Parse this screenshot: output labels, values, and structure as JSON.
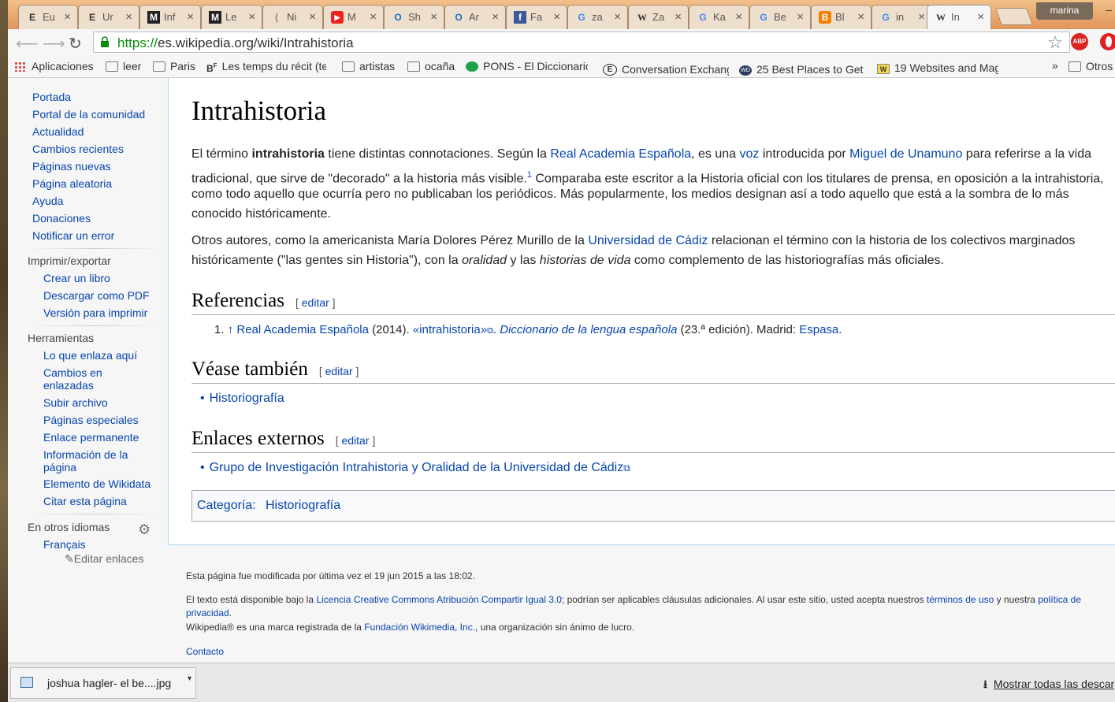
{
  "browser": {
    "tabs": [
      {
        "favicon": "E",
        "title": "Eu"
      },
      {
        "favicon": "E",
        "title": "Ur"
      },
      {
        "favicon": "M",
        "title": "Inf"
      },
      {
        "favicon": "M",
        "title": "Le"
      },
      {
        "favicon": "(",
        "title": "Ni"
      },
      {
        "favicon": "▶",
        "title": "M"
      },
      {
        "favicon": "O",
        "title": "Sh"
      },
      {
        "favicon": "O",
        "title": "Ar"
      },
      {
        "favicon": "f",
        "title": "Fa"
      },
      {
        "favicon": "G",
        "title": "za"
      },
      {
        "favicon": "W",
        "title": "Za"
      },
      {
        "favicon": "G",
        "title": "Ka"
      },
      {
        "favicon": "G",
        "title": "Be"
      },
      {
        "favicon": "B",
        "title": "Bl"
      },
      {
        "favicon": "G",
        "title": "in"
      },
      {
        "favicon": "W",
        "title": "In"
      }
    ],
    "profile": "marina",
    "url_scheme": "https://",
    "url_rest": "es.wikipedia.org/wiki/Intrahistoria",
    "abp_label": "ABP",
    "bookmarks": [
      {
        "icon": "apps-grid-icon",
        "label": "Aplicaciones"
      },
      {
        "icon": "folder-icon",
        "label": "leer"
      },
      {
        "icon": "folder-icon",
        "label": "Paris"
      },
      {
        "icon": "bf-icon",
        "label": "Les temps du récit (te"
      },
      {
        "icon": "folder-icon",
        "label": "artistas"
      },
      {
        "icon": "folder-icon",
        "label": "ocaña"
      },
      {
        "icon": "pons-icon",
        "label": "PONS - El Diccionario"
      },
      {
        "icon": "e-icon",
        "label": "Conversation Exchang"
      },
      {
        "icon": "wd-icon",
        "label": "25 Best Places to Get"
      },
      {
        "icon": "w-icon",
        "label": "19 Websites and Mag"
      }
    ],
    "bookmarks_overflow": "»",
    "other_bookmarks": "Otros"
  },
  "sidebar": {
    "nav": [
      "Portada",
      "Portal de la comunidad",
      "Actualidad",
      "Cambios recientes",
      "Páginas nuevas",
      "Página aleatoria",
      "Ayuda",
      "Donaciones",
      "Notificar un error"
    ],
    "print_heading": "Imprimir/exportar",
    "print": [
      "Crear un libro",
      "Descargar como PDF",
      "Versión para imprimir"
    ],
    "tools_heading": "Herramientas",
    "tools": [
      "Lo que enlaza aquí",
      "Cambios en",
      "enlazadas",
      "Subir archivo",
      "Páginas especiales",
      "Enlace permanente",
      "Información de la",
      "página",
      "Elemento de Wikidata",
      "Citar esta página"
    ],
    "lang_heading": "En otros idiomas",
    "langs": [
      "Français"
    ],
    "edit_links": "Editar enlaces"
  },
  "article": {
    "title": "Intrahistoria",
    "p1": {
      "a": "El término ",
      "b": "intrahistoria",
      "c": " tiene distintas connotaciones. Según la ",
      "d": "Real Academia Española",
      "e": ", es una ",
      "f": "voz",
      "g": " introducida por ",
      "h": "Miguel de Unamuno",
      "i": " para referirse a la vida",
      "l2a": "tradicional, que sirve de \"decorado\" a la historia más visible.",
      "sup": "1",
      "l2b": " Comparaba este escritor a la Historia oficial con los titulares de prensa, en oposición a la intrahistoria,",
      "l3": "como todo aquello que ocurría pero no publicaban los periódicos. Más popularmente, los medios designan así a todo aquello que está a la sombra de lo más",
      "l4": "conocido históricamente."
    },
    "p2": {
      "a": "Otros autores, como la americanista María Dolores Pérez Murillo de la ",
      "b": "Universidad de Cádiz",
      "c": " relacionan el término con la historia de los colectivos marginados",
      "l2a": "históricamente (\"las gentes sin Historia\"), con la ",
      "l2b": "oralidad",
      "l2c": " y las ",
      "l2d": "historias de vida",
      "l2e": " como complemento de las historiografías más oficiales."
    },
    "edit_label": "editar",
    "refs_heading": "Referencias",
    "ref": {
      "num": "1.",
      "arrow": "↑",
      "a": "Real Academia Española",
      "b": " (2014). ",
      "c": "«intrahistoria»",
      "d": ". ",
      "e": "Diccionario de la lengua española",
      "f": " (23.ª edición). Madrid: ",
      "g": "Espasa",
      "h": "."
    },
    "see_heading": "Véase también",
    "see": [
      "Historiografía"
    ],
    "ext_heading": "Enlaces externos",
    "ext": [
      "Grupo de Investigación Intrahistoria y Oralidad de la Universidad de Cádiz"
    ],
    "cat_label": "Categoría:",
    "cat": "Historiografía"
  },
  "footer": {
    "modified": "Esta página fue modificada por última vez el 19 jun 2015 a las 18:02.",
    "lic_a": "El texto está disponible bajo la ",
    "lic_b": "Licencia Creative Commons Atribución Compartir Igual 3.0",
    "lic_c": "; podrían ser aplicables cláusulas adicionales. Al usar este sitio, usted acepta nuestros ",
    "lic_d": "términos de uso",
    "lic_e": " y nuestra ",
    "lic_f": "política de",
    "lic_g": "privacidad",
    "lic_h": ".",
    "tm_a": "Wikipedia® es una marca registrada de la ",
    "tm_b": "Fundación Wikimedia, Inc.",
    "tm_c": ", una organización sin ánimo de lucro.",
    "contact": "Contacto"
  },
  "downloads": {
    "file": "joshua hagler- el be....jpg",
    "show_all": "Mostrar todas las descargas"
  }
}
